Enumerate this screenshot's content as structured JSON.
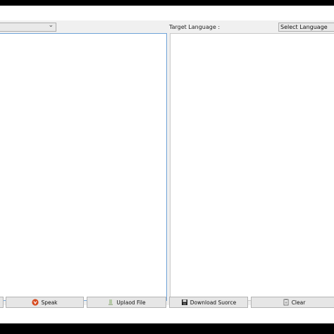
{
  "target_label": "Target Language :",
  "target_select": {
    "value": "Select Language"
  },
  "source_select": {
    "value": ""
  },
  "buttons": {
    "speak": "Speak",
    "upload": "Uplaod File",
    "download": "Download  Suorce",
    "clear": "Clear"
  },
  "colors": {
    "background": "#000000",
    "toolbar": "#f0f0f0",
    "focus_border": "#6fa3d8",
    "speak_icon": "#d64a1f"
  },
  "icons": {
    "speak": "speaker-icon",
    "upload": "upload-icon",
    "download": "download-icon",
    "clear": "clear-icon"
  }
}
